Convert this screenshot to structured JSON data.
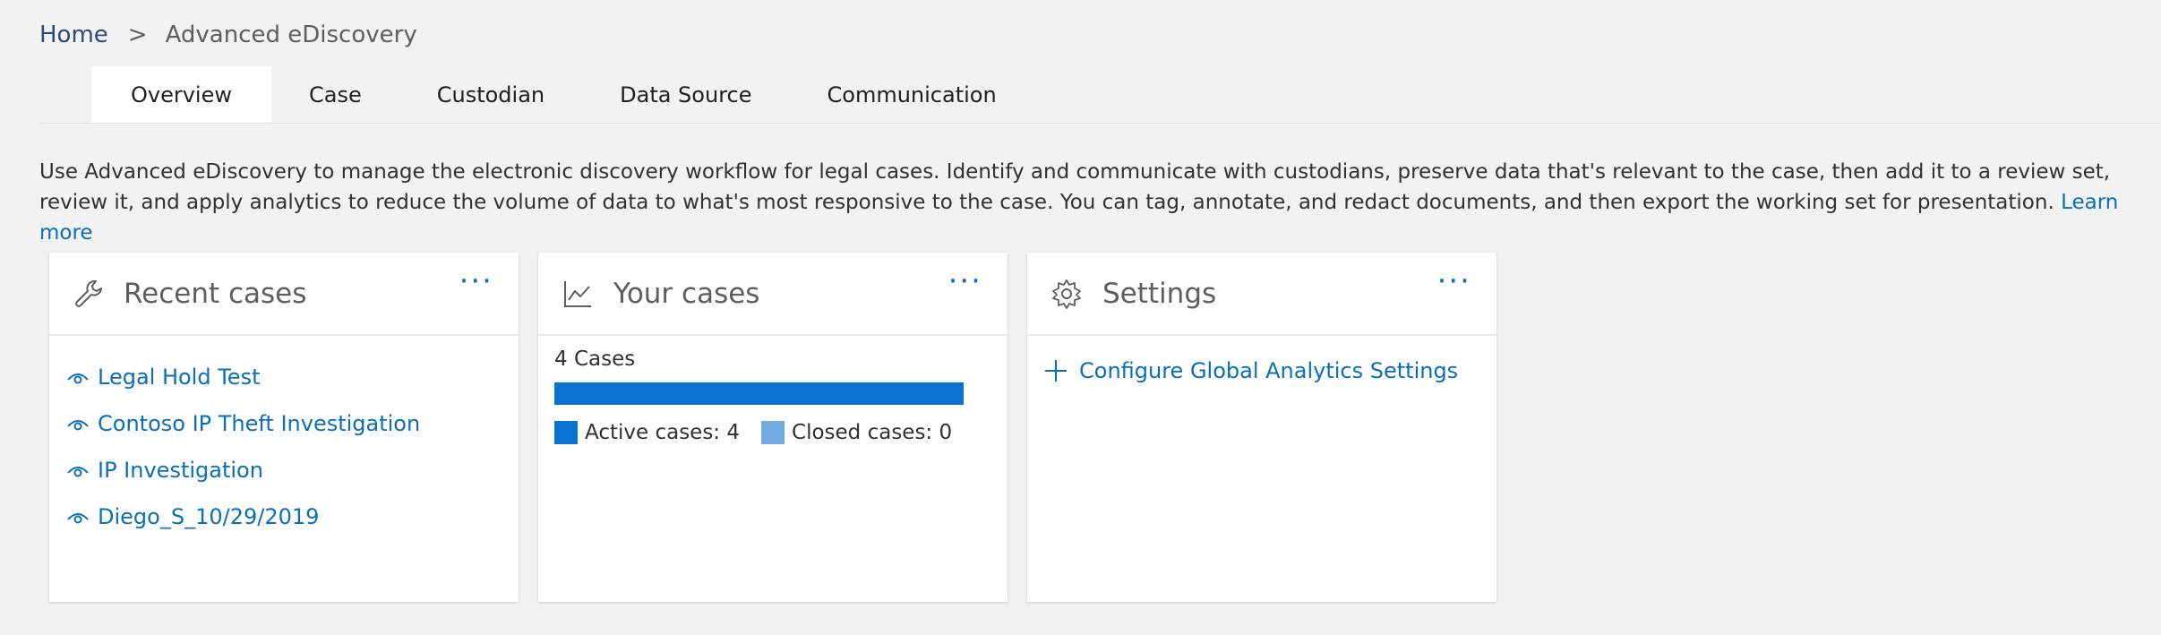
{
  "breadcrumb": {
    "home": "Home",
    "separator": ">",
    "current": "Advanced eDiscovery"
  },
  "tabs": [
    {
      "label": "Overview",
      "active": true
    },
    {
      "label": "Case",
      "active": false
    },
    {
      "label": "Custodian",
      "active": false
    },
    {
      "label": "Data Source",
      "active": false
    },
    {
      "label": "Communication",
      "active": false
    }
  ],
  "intro": {
    "text": "Use Advanced eDiscovery to manage the electronic discovery workflow for legal cases. Identify and communicate with custodians, preserve data that's relevant to the case, then add it to a review set, review it, and apply analytics to reduce the volume of data to what's most responsive to the case. You can tag, annotate, and redact documents, and then export the working set for presentation.",
    "link": "Learn more"
  },
  "cards": {
    "recent": {
      "title": "Recent cases",
      "icon": "wrench-icon",
      "more": "···",
      "items": [
        "Legal Hold Test",
        "Contoso IP Theft Investigation",
        "IP Investigation",
        "Diego_S_10/29/2019"
      ],
      "item_icon": "eye-icon"
    },
    "your_cases": {
      "title": "Your cases",
      "icon": "line-chart-icon",
      "more": "···",
      "count_label": "4 Cases",
      "active_label": "Active cases: 4",
      "closed_label": "Closed cases: 0",
      "active_fraction": 1.0,
      "active_color": "#0a73d1",
      "closed_color": "#71a9e0"
    },
    "settings": {
      "title": "Settings",
      "icon": "gear-icon",
      "more": "···",
      "action": "Configure Global Analytics Settings",
      "action_icon": "plus-icon"
    }
  },
  "colors": {
    "accent": "#0b6fb7",
    "background": "#f2f2f2"
  }
}
